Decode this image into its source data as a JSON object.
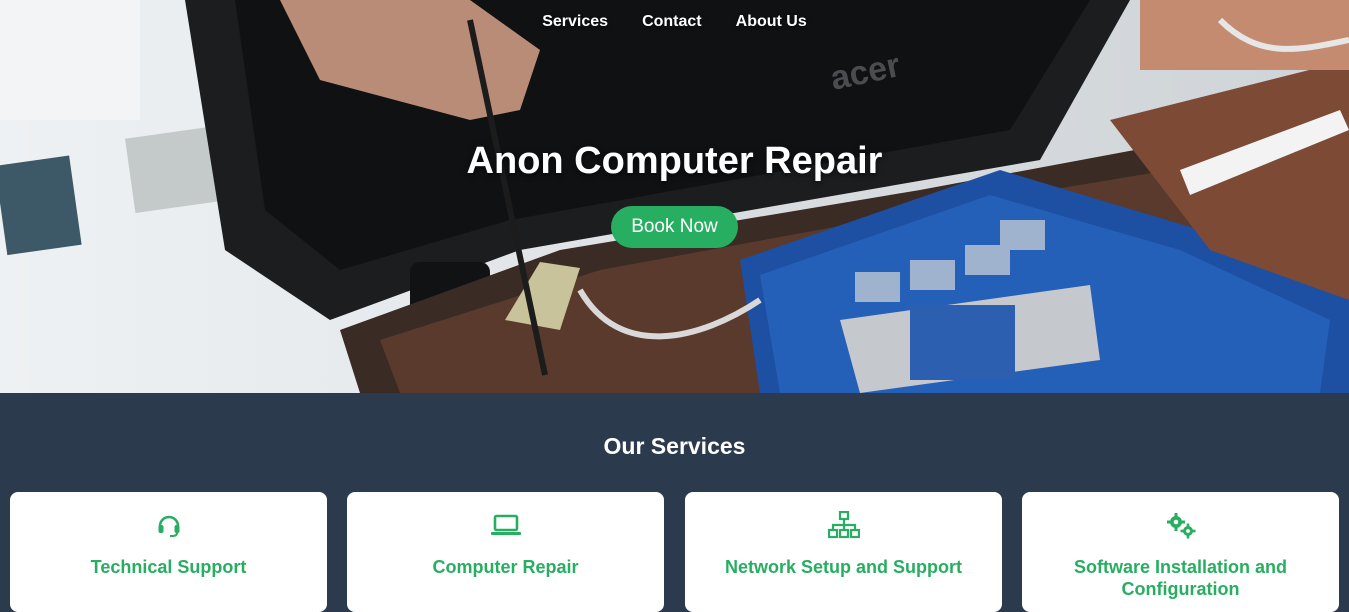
{
  "nav": {
    "items": [
      "Services",
      "Contact",
      "About Us"
    ]
  },
  "hero": {
    "title": "Anon Computer Repair",
    "cta_label": "Book Now",
    "laptop_brand": "acer"
  },
  "services": {
    "heading": "Our Services",
    "cards": [
      {
        "title": "Technical Support",
        "icon": "headset-icon"
      },
      {
        "title": "Computer Repair",
        "icon": "laptop-icon"
      },
      {
        "title": "Network Setup and Support",
        "icon": "network-icon"
      },
      {
        "title": "Software Installation and Configuration",
        "icon": "gears-icon"
      }
    ]
  },
  "colors": {
    "accent": "#27ae60",
    "section_bg": "#2c3a4e",
    "card_bg": "#ffffff"
  }
}
